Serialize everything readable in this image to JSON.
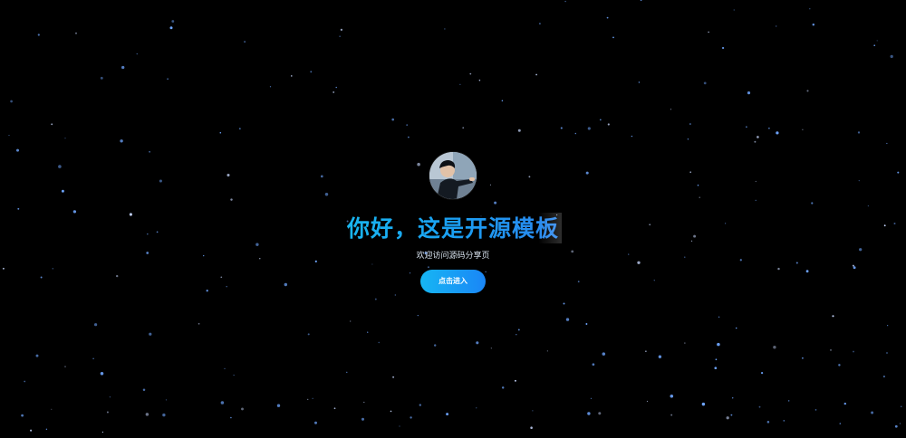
{
  "hero": {
    "title": "你好，这是开源模板",
    "subtitle": "欢迎访问源码分享页",
    "enter_button_label": "点击进入"
  },
  "avatar": {
    "icon": "person-photo-avatar"
  },
  "colors": {
    "background": "#000000",
    "star": "#6fa6ff",
    "accent_start": "#19b6f0",
    "accent_end": "#1a86f6"
  }
}
